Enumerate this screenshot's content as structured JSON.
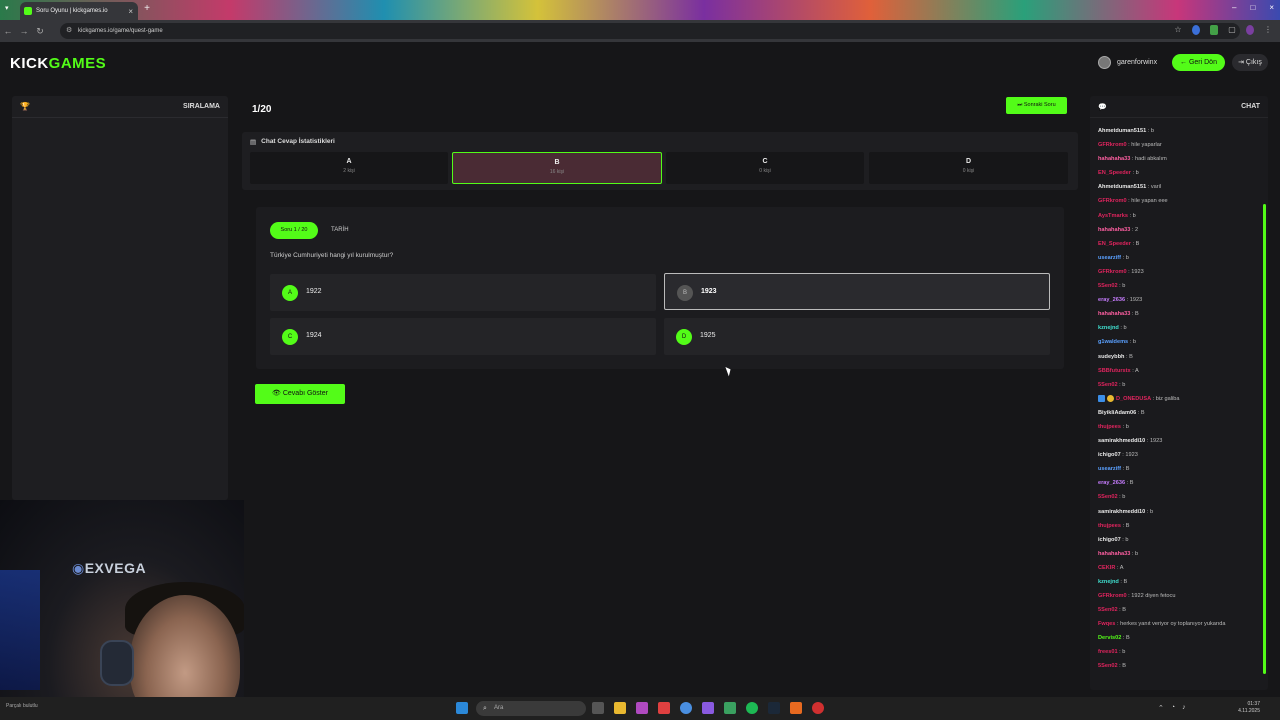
{
  "browser": {
    "tab_title": "Soru Oyunu | kickgames.io",
    "tab_close": "×",
    "new_tab": "+",
    "url": "kickgames.io/game/quest-game",
    "win_min": "–",
    "win_max": "□",
    "win_close": "×",
    "back": "←",
    "forward": "→",
    "reload": "↻"
  },
  "header": {
    "logo_main": "KICK",
    "logo_accent": "GAMES",
    "username": "garenforwinx",
    "back_button": "← Geri Dön",
    "exit_button": "⇥ Çıkış"
  },
  "left_panel": {
    "title": "SIRALAMA"
  },
  "webcam": {
    "brand": "EXVEGA"
  },
  "game": {
    "counter": "1/20",
    "next_button": "⏭ Sonraki Soru",
    "stats_title": "Chat Cevap İstatistikleri",
    "stats": [
      {
        "letter": "A",
        "count": "2 kişi"
      },
      {
        "letter": "B",
        "count": "16 kişi"
      },
      {
        "letter": "C",
        "count": "0 kişi"
      },
      {
        "letter": "D",
        "count": "0 kişi"
      }
    ],
    "question_badge": "Soru 1 / 20",
    "category": "TARİH",
    "question": "Türkiye Cumhuriyeti hangi yıl kurulmuştur?",
    "options": [
      {
        "letter": "A",
        "value": "1922"
      },
      {
        "letter": "B",
        "value": "1923"
      },
      {
        "letter": "C",
        "value": "1924"
      },
      {
        "letter": "D",
        "value": "1925"
      }
    ],
    "show_answer_button": "👁 Cevabı Göster"
  },
  "chat": {
    "title": "CHAT",
    "messages": [
      {
        "user": "Ahmetduman5151",
        "text": "b",
        "color": "#e8e8e8"
      },
      {
        "user": "GFRkrom0",
        "text": "hile yaparlar",
        "color": "#e0245e"
      },
      {
        "user": "hahahaha33",
        "text": "hadi abkalım",
        "color": "#ff5fa2"
      },
      {
        "user": "EN_Speeder",
        "text": "b",
        "color": "#e0245e"
      },
      {
        "user": "Ahmetduman5151",
        "text": "varil",
        "color": "#e8e8e8"
      },
      {
        "user": "GFRkrom0",
        "text": "hile yapan eee",
        "color": "#e0245e"
      },
      {
        "user": "AysTmarks",
        "text": "b",
        "color": "#e0245e"
      },
      {
        "user": "hahahaha33",
        "text": "2",
        "color": "#ff5fa2"
      },
      {
        "user": "EN_Speeder",
        "text": "B",
        "color": "#e0245e"
      },
      {
        "user": "usearziff",
        "text": "b",
        "color": "#5aa0ff"
      },
      {
        "user": "GFRkrom0",
        "text": "1923",
        "color": "#e0245e"
      },
      {
        "user": "5Sen02",
        "text": "b",
        "color": "#e0245e"
      },
      {
        "user": "eray_2636",
        "text": "1923",
        "color": "#c77dff"
      },
      {
        "user": "hahahaha33",
        "text": "B",
        "color": "#ff5fa2"
      },
      {
        "user": "kznejnd",
        "text": "b",
        "color": "#40e0d0"
      },
      {
        "user": "g1waldems",
        "text": "b",
        "color": "#5aa0ff"
      },
      {
        "user": "sudeybbh",
        "text": "B",
        "color": "#e8e8e8"
      },
      {
        "user": "SBBfuturstx",
        "text": "A",
        "color": "#e0245e"
      },
      {
        "user": "5Sen02",
        "text": "b",
        "color": "#e0245e"
      },
      {
        "user": "D_ONEDUSA",
        "text": "biz galiba",
        "color": "#e0245e",
        "badges": true
      },
      {
        "user": "BiyikliAdam06",
        "text": "B",
        "color": "#e8e8e8"
      },
      {
        "user": "thujpees",
        "text": "b",
        "color": "#e0245e"
      },
      {
        "user": "samirakhmeddi10",
        "text": "1923",
        "color": "#e8e8e8"
      },
      {
        "user": "ichigo07",
        "text": "1923",
        "color": "#e8e8e8"
      },
      {
        "user": "usearziff",
        "text": "B",
        "color": "#5aa0ff"
      },
      {
        "user": "eray_2636",
        "text": "B",
        "color": "#c77dff"
      },
      {
        "user": "5Sen02",
        "text": "b",
        "color": "#e0245e"
      },
      {
        "user": "samirakhmeddi10",
        "text": "b",
        "color": "#e8e8e8"
      },
      {
        "user": "thujpees",
        "text": "B",
        "color": "#e0245e"
      },
      {
        "user": "ichigo07",
        "text": "b",
        "color": "#e8e8e8"
      },
      {
        "user": "hahahaha33",
        "text": "b",
        "color": "#ff5fa2"
      },
      {
        "user": "CEKIR",
        "text": "A",
        "color": "#e0245e"
      },
      {
        "user": "kznejnd",
        "text": "B",
        "color": "#40e0d0"
      },
      {
        "user": "GFRkrom0",
        "text": "1922 diyen fetocu",
        "color": "#e0245e"
      },
      {
        "user": "5Sen02",
        "text": "B",
        "color": "#e0245e"
      },
      {
        "user": "Fwqes",
        "text": "herkes yanıt veriyor oy toplanıyor yukarıda",
        "color": "#e0245e",
        "wrap": true
      },
      {
        "user": "Dervis02",
        "text": "B",
        "color": "#53fc18"
      },
      {
        "user": "frees01",
        "text": "b",
        "color": "#e0245e"
      },
      {
        "user": "5Sen02",
        "text": "B",
        "color": "#e0245e"
      }
    ]
  },
  "taskbar": {
    "search_placeholder": "Ara",
    "left_text": "Parçalı bulutlu",
    "time": "01:37",
    "date": "4.11.2025"
  }
}
